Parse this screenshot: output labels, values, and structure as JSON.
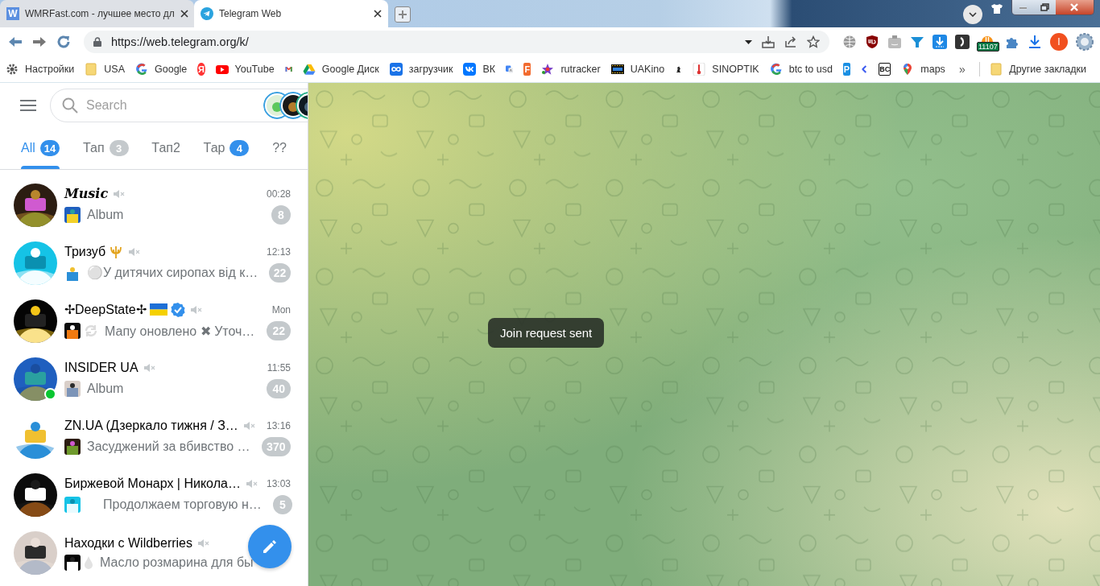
{
  "browser": {
    "tabs": [
      {
        "title": "WMRFast.com - лучшее место дл",
        "favicon_letter": "W",
        "selected": false
      },
      {
        "title": "Telegram Web",
        "selected": true
      }
    ],
    "address": "https://web.telegram.org/k/",
    "extension_badge": "11107",
    "profile_letter": "I",
    "bookmarks": [
      {
        "kind": "settings",
        "label": "Настройки"
      },
      {
        "kind": "folder",
        "label": "USA"
      },
      {
        "kind": "google",
        "label": "Google"
      },
      {
        "kind": "glyph",
        "glyph": "Я"
      },
      {
        "kind": "youtube",
        "label": "YouTube"
      },
      {
        "kind": "mail"
      },
      {
        "kind": "drive",
        "label": "Google Диск"
      },
      {
        "kind": "infinity",
        "label": "загрузчик"
      },
      {
        "kind": "vk",
        "label": "ВК"
      },
      {
        "kind": "translate"
      },
      {
        "kind": "glyph",
        "glyph": "F"
      },
      {
        "kind": "star",
        "label": "rutracker"
      },
      {
        "kind": "film",
        "label": "UAKino"
      },
      {
        "kind": "knight"
      },
      {
        "kind": "thermometer",
        "label": "SINOPTIK"
      },
      {
        "kind": "google",
        "label": "btc to usd"
      },
      {
        "kind": "glyph",
        "glyph": "P"
      },
      {
        "kind": "chevron"
      },
      {
        "kind": "glyph",
        "glyph": "BC"
      },
      {
        "kind": "pin",
        "label": "maps"
      }
    ],
    "more": "»",
    "other_bookmarks": "Другие закладки"
  },
  "sidebar": {
    "search_placeholder": "Search",
    "folders": [
      {
        "label": "All",
        "count": "14",
        "count_muted": false,
        "selected": true
      },
      {
        "label": "Тап",
        "count": "3",
        "count_muted": true,
        "selected": false
      },
      {
        "label": "Тап2",
        "selected": false
      },
      {
        "label": "Тар",
        "count": "4",
        "count_muted": false,
        "selected": false
      },
      {
        "label": "??",
        "selected": false
      }
    ],
    "chats": [
      {
        "name": "𝑴𝒖𝒔𝒊𝒄",
        "muted": true,
        "verified": false,
        "online": false,
        "time": "00:28",
        "preview": "Album",
        "unread": "8"
      },
      {
        "name": "Тризуб",
        "muted": true,
        "verified": false,
        "online": false,
        "time": "12:13",
        "preview": "⚪У дитячих сиропах від к…",
        "unread": "22"
      },
      {
        "name": "✢DeepState✢",
        "muted": true,
        "verified": true,
        "online": false,
        "time": "Mon",
        "preview": "Мапу оновлено ✖ Уточ…",
        "unread": "22"
      },
      {
        "name": "INSIDER UA",
        "muted": true,
        "verified": false,
        "online": true,
        "time": "11:55",
        "preview": "Album",
        "unread": "40"
      },
      {
        "name": "ZN.UA (Дзеркало тижня / З…",
        "muted": true,
        "verified": false,
        "online": false,
        "time": "13:16",
        "preview": "Засуджений за вбивство …",
        "unread": "370"
      },
      {
        "name": "Биржевой Монарх | Никола…",
        "muted": true,
        "verified": false,
        "online": false,
        "time": "13:03",
        "preview": "Продолжаем торговую н…",
        "unread": "5"
      },
      {
        "name": "Находки с Wildberries",
        "muted": true,
        "verified": false,
        "online": false,
        "preview": "Масло розмарина для бы"
      }
    ]
  },
  "chat": {
    "toast": "Join request sent"
  }
}
